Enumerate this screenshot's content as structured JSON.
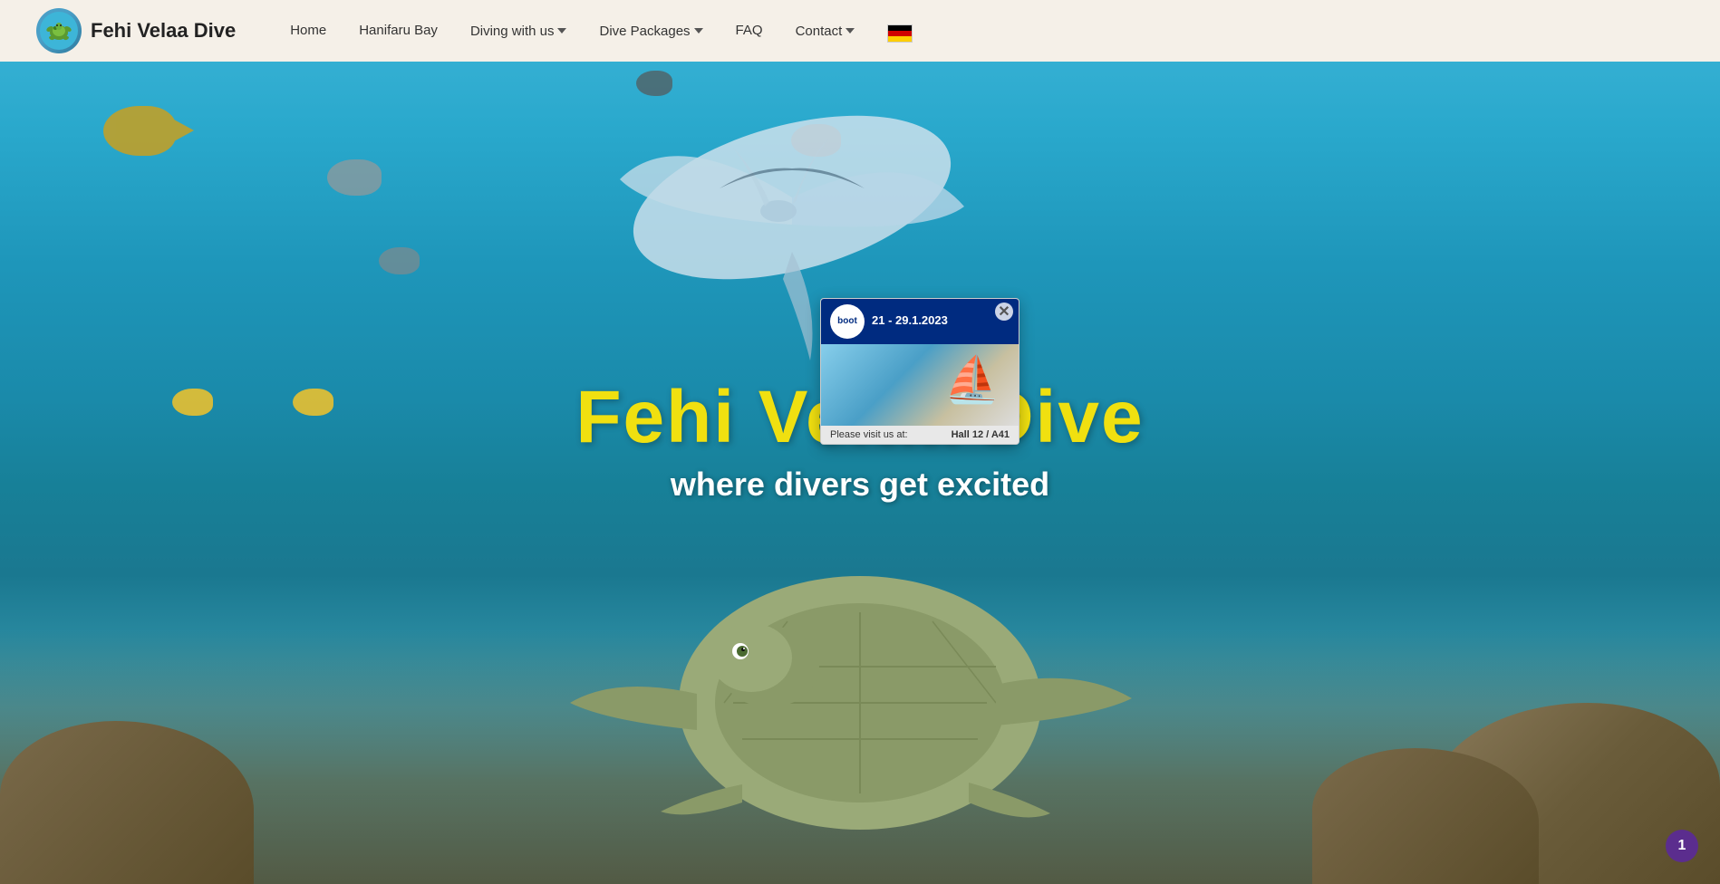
{
  "brand": {
    "name": "Fehi Velaa Dive"
  },
  "navbar": {
    "links": [
      {
        "id": "home",
        "label": "Home",
        "has_dropdown": false
      },
      {
        "id": "hanifaru-bay",
        "label": "Hanifaru Bay",
        "has_dropdown": false
      },
      {
        "id": "diving-with-us",
        "label": "Diving with us",
        "has_dropdown": true
      },
      {
        "id": "dive-packages",
        "label": "Dive Packages",
        "has_dropdown": true
      },
      {
        "id": "faq",
        "label": "FAQ",
        "has_dropdown": false
      },
      {
        "id": "contact",
        "label": "Contact",
        "has_dropdown": true
      }
    ]
  },
  "hero": {
    "title_part1": "Fehi",
    "title_part2": "Velaa",
    "title_part3": "Dive",
    "full_title": "Fehi Velaa Dive",
    "subtitle": "where divers get excited"
  },
  "popup": {
    "logo_text": "boot",
    "date_line1": "21 - 29.1.2023",
    "visit_text": "Please visit us at:",
    "hall_text": "Hall 12 / A41",
    "close_label": "✕"
  },
  "notification": {
    "count": "1"
  }
}
